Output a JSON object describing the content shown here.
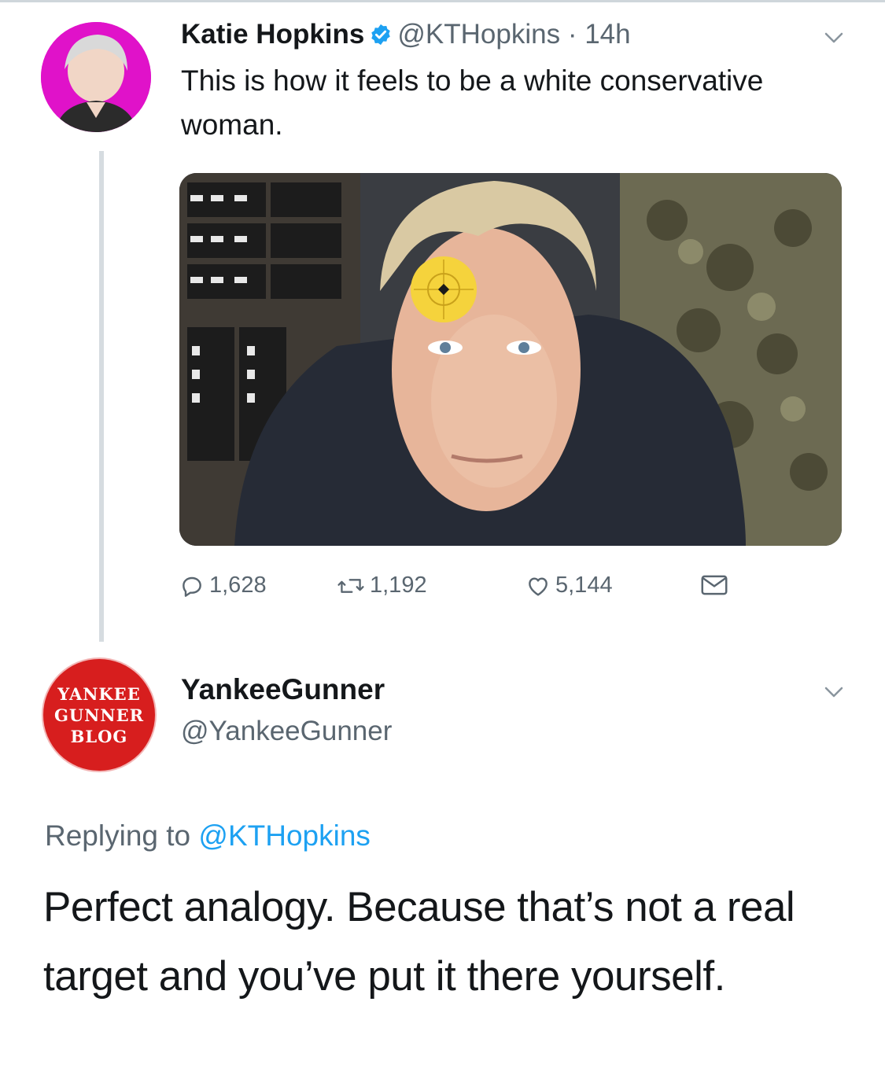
{
  "tweet": {
    "author_name": "Katie Hopkins",
    "handle": "@KTHopkins",
    "separator": "·",
    "time": "14h",
    "text": "This is how it feels to be a white conservative woman.",
    "stats": {
      "replies": "1,628",
      "retweets": "1,192",
      "likes": "5,144"
    }
  },
  "reply": {
    "author_name": "YankeeGunner",
    "handle": "@YankeeGunner",
    "avatar_logo_lines": [
      "YANKEE",
      "GUNNER",
      "BLOG"
    ],
    "replying_prefix": "Replying to",
    "replying_to": "@KTHopkins",
    "text": "Perfect analogy. Because that’s not a real target and you’ve put it there yourself."
  },
  "icons": {
    "verified": "verified-badge-icon",
    "reply": "reply-icon",
    "retweet": "retweet-icon",
    "like": "heart-icon",
    "dm": "envelope-icon",
    "menu": "chevron-down-icon"
  },
  "colors": {
    "link_blue": "#1da1f2",
    "secondary_text": "#5a6670",
    "avatar1_bg": "#e012c9",
    "avatar2_bg": "#d71e1e"
  }
}
